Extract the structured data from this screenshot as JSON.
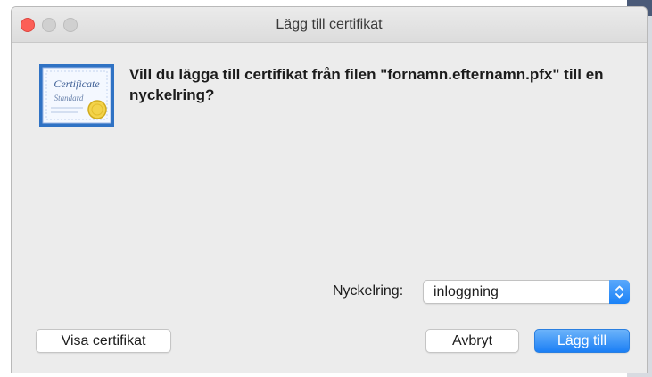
{
  "window": {
    "title": "Lägg till certifikat"
  },
  "icons": {
    "certificate": "certificate-icon",
    "keychain_arrows": "up-down-chevron-icon"
  },
  "certificate_icon_text": {
    "line1": "Certificate",
    "line2": "Standard"
  },
  "message": {
    "text": "Vill du lägga till certifikat från filen \"fornamn.efternamn.pfx\" till en nyckelring?"
  },
  "keychain": {
    "label": "Nyckelring:",
    "selected": "inloggning"
  },
  "buttons": {
    "show_certificate": "Visa certifikat",
    "cancel": "Avbryt",
    "add": "Lägg till"
  },
  "colors": {
    "accent": "#1a82f7",
    "close_button": "#fc5f57",
    "dialog_bg": "#ececec"
  }
}
